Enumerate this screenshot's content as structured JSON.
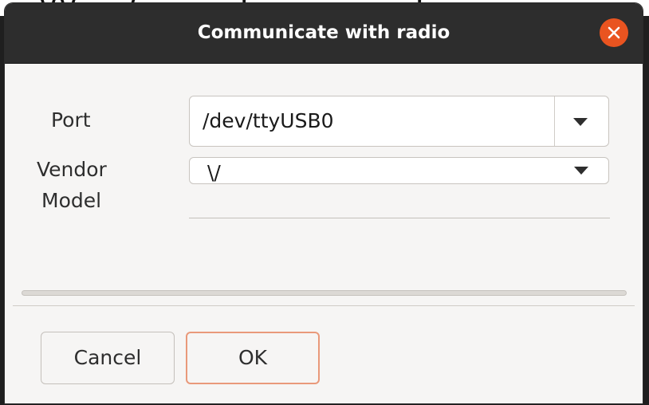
{
  "window": {
    "title": "Communicate with radio"
  },
  "form": {
    "port_label": "Port",
    "port_value": "/dev/ttyUSB0",
    "vendor_label": "Vendor",
    "vendor_value": "\\/",
    "model_label": "Model",
    "model_value": ""
  },
  "progress": {
    "value": 0
  },
  "buttons": {
    "cancel_label": "Cancel",
    "ok_label": "OK"
  },
  "colors": {
    "titlebar": "#2d2d2d",
    "close_button": "#e95420",
    "ok_focus_border": "#e9997a",
    "dialog_bg": "#f6f5f4"
  },
  "icons": {
    "close": "close-icon",
    "dropdown": "triangle-down-icon"
  }
}
